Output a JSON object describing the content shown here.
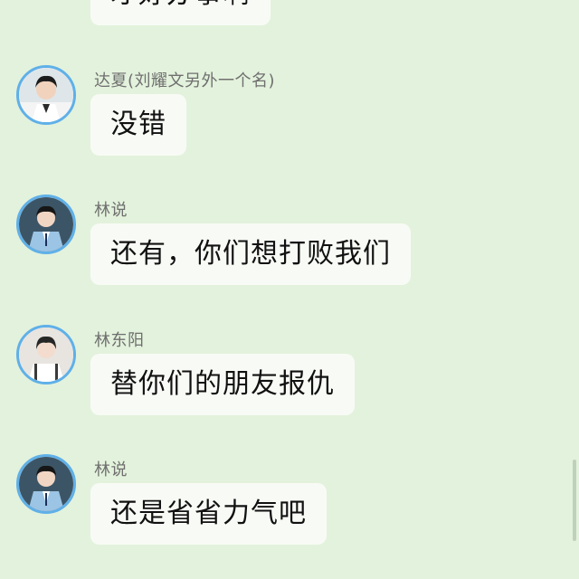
{
  "messages": [
    {
      "text": "才好办事啊"
    },
    {
      "sender": "达夏(刘耀文另外一个名)",
      "text": "没错",
      "avatar": "avatar-boy-white-jacket"
    },
    {
      "sender": "林说",
      "text": "还有，你们想打败我们",
      "avatar": "avatar-boy-blue-uniform"
    },
    {
      "sender": "林东阳",
      "text": "替你们的朋友报仇",
      "avatar": "avatar-boy-white-shirt"
    },
    {
      "sender": "林说",
      "text": "还是省省力气吧",
      "avatar": "avatar-boy-blue-uniform"
    }
  ],
  "colors": {
    "background": "#e3f2dc",
    "bubble": "#f8fbf5",
    "avatar_border": "#5fb0e8",
    "sender_text": "#6f6f6f"
  }
}
